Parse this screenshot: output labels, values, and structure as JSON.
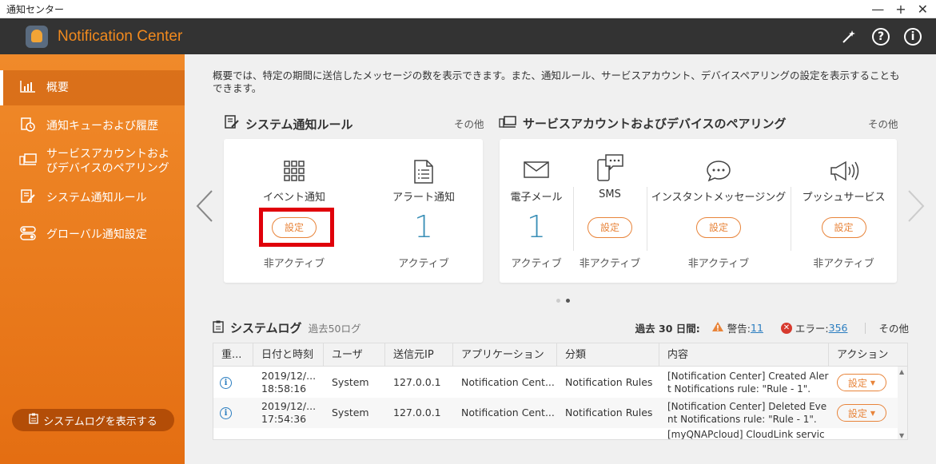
{
  "window": {
    "title": "通知センター",
    "minimize": "—",
    "maximize": "+",
    "close": "✕"
  },
  "app": {
    "title": "Notification Center"
  },
  "sidebar": {
    "items": [
      {
        "label": "概要",
        "icon": "chart-icon"
      },
      {
        "label": "通知キューおよび履歴",
        "icon": "history-icon"
      },
      {
        "label": "サービスアカウントおよびデバイスのペアリング",
        "icon": "devices-icon"
      },
      {
        "label": "システム通知ルール",
        "icon": "rules-icon"
      },
      {
        "label": "グローバル通知設定",
        "icon": "toggle-icon"
      }
    ],
    "log_button": "システムログを表示する"
  },
  "main": {
    "description": "概要では、特定の期間に送信したメッセージの数を表示できます。また、通知ルール、サービスアカウント、デバイスペアリングの設定を表示することもできます。",
    "rules": {
      "title": "システム通知ルール",
      "more": "その他",
      "items": [
        {
          "label": "イベント通知",
          "button": "設定",
          "status": "非アクティブ"
        },
        {
          "label": "アラート通知",
          "count": "1",
          "status": "アクティブ"
        }
      ]
    },
    "pairing": {
      "title": "サービスアカウントおよびデバイスのペアリング",
      "more": "その他",
      "items": [
        {
          "label": "電子メール",
          "count": "1",
          "status": "アクティブ"
        },
        {
          "label": "SMS",
          "button": "設定",
          "status": "非アクティブ"
        },
        {
          "label": "インスタントメッセージング",
          "button": "設定",
          "status": "非アクティブ"
        },
        {
          "label": "プッシュサービス",
          "button": "設定",
          "status": "非アクティブ"
        }
      ]
    },
    "log": {
      "title": "システムログ",
      "subtitle": "過去50ログ",
      "period": "過去 30 日間:",
      "warning_label": "警告:",
      "warning_count": "11",
      "error_label": "エラー:",
      "error_count": "356",
      "more": "その他",
      "columns": [
        "重...",
        "日付と時刻",
        "ユーザ",
        "送信元IP",
        "アプリケーション",
        "分類",
        "内容",
        "アクション"
      ],
      "rows": [
        {
          "date": "2019/12/...",
          "time": "18:58:16",
          "user": "System",
          "ip": "127.0.0.1",
          "app": "Notification Cent...",
          "category": "Notification Rules",
          "content": "[Notification Center] Created Alert Notifications rule: \"Rule - 1\".",
          "action": "設定"
        },
        {
          "date": "2019/12/...",
          "time": "17:54:36",
          "user": "System",
          "ip": "127.0.0.1",
          "app": "Notification Cent...",
          "category": "Notification Rules",
          "content": "[Notification Center] Deleted Event Notifications rule: \"Rule - 1\".",
          "action": "設定"
        }
      ],
      "partial_row": "[myQNAPcloud] CloudLink servic"
    }
  }
}
